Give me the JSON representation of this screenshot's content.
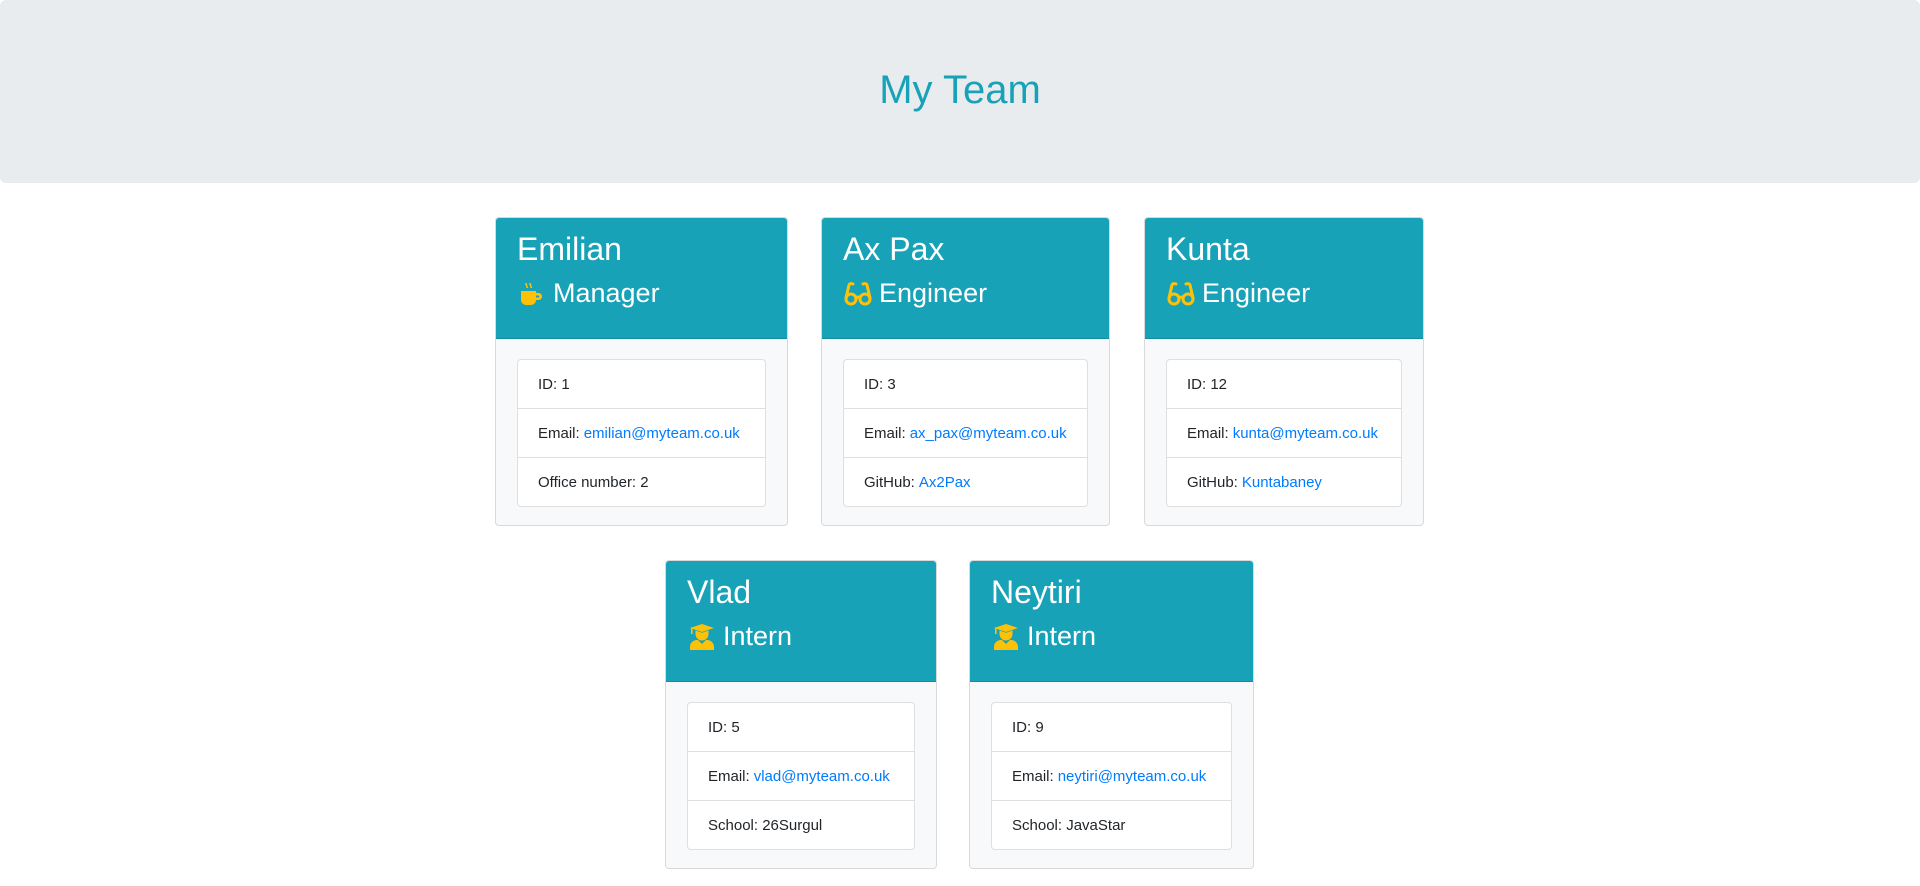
{
  "header": {
    "title": "My Team"
  },
  "colors": {
    "header_bg": "#e9ecef",
    "title": "#17a2b8",
    "card_header_bg": "#17a2b8",
    "icon": "#ffc107",
    "link": "#007bff",
    "card_body_bg": "#f8f9fa"
  },
  "team": [
    {
      "name": "Emilian",
      "role": "Manager",
      "icon": "mug-hot-icon",
      "id_label": "ID:",
      "id": "1",
      "email_label": "Email:",
      "email": "emilian@myteam.co.uk",
      "extra_label": "Office number:",
      "extra_value": "2",
      "extra_is_link": false
    },
    {
      "name": "Ax Pax",
      "role": "Engineer",
      "icon": "glasses-icon",
      "id_label": "ID:",
      "id": "3",
      "email_label": "Email:",
      "email": "ax_pax@myteam.co.uk",
      "extra_label": "GitHub:",
      "extra_value": "Ax2Pax",
      "extra_is_link": true
    },
    {
      "name": "Kunta",
      "role": "Engineer",
      "icon": "glasses-icon",
      "id_label": "ID:",
      "id": "12",
      "email_label": "Email:",
      "email": "kunta@myteam.co.uk",
      "extra_label": "GitHub:",
      "extra_value": "Kuntabaney",
      "extra_is_link": true
    },
    {
      "name": "Vlad",
      "role": "Intern",
      "icon": "user-graduate-icon",
      "id_label": "ID:",
      "id": "5",
      "email_label": "Email:",
      "email": "vlad@myteam.co.uk",
      "extra_label": "School:",
      "extra_value": "26Surgul",
      "extra_is_link": false
    },
    {
      "name": "Neytiri",
      "role": "Intern",
      "icon": "user-graduate-icon",
      "id_label": "ID:",
      "id": "9",
      "email_label": "Email:",
      "email": "neytiri@myteam.co.uk",
      "extra_label": "School:",
      "extra_value": "JavaStar",
      "extra_is_link": false
    }
  ]
}
